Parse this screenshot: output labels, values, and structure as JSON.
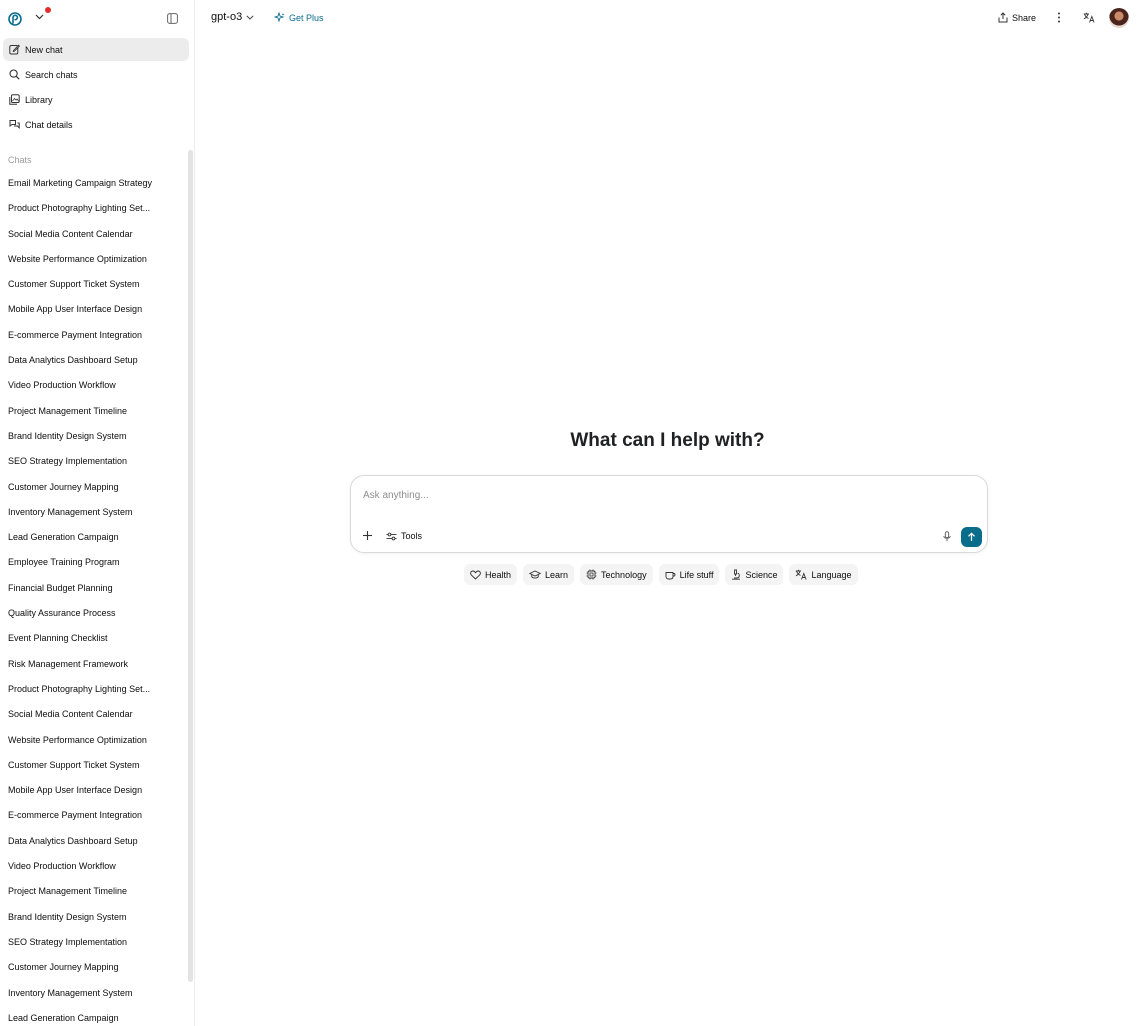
{
  "sidebar": {
    "nav": [
      {
        "label": "New chat",
        "icon": "edit-icon"
      },
      {
        "label": "Search chats",
        "icon": "search-icon"
      },
      {
        "label": "Library",
        "icon": "library-icon"
      },
      {
        "label": "Chat details",
        "icon": "chat-details-icon"
      }
    ],
    "chats_label": "Chats",
    "chats": [
      "Email Marketing Campaign Strategy",
      "Product Photography Lighting Set...",
      "Social Media Content Calendar",
      "Website Performance Optimization",
      "Customer Support Ticket System",
      "Mobile App User Interface Design",
      "E-commerce Payment Integration",
      "Data Analytics Dashboard Setup",
      "Video Production Workflow",
      "Project Management Timeline",
      "Brand Identity Design System",
      "SEO Strategy Implementation",
      "Customer Journey Mapping",
      "Inventory Management System",
      "Lead Generation Campaign",
      "Employee Training Program",
      "Financial Budget Planning",
      "Quality Assurance Process",
      "Event Planning Checklist",
      "Risk Management Framework",
      "Product Photography Lighting Set...",
      "Social Media Content Calendar",
      "Website Performance Optimization",
      "Customer Support Ticket System",
      "Mobile App User Interface Design",
      "E-commerce Payment Integration",
      "Data Analytics Dashboard Setup",
      "Video Production Workflow",
      "Project Management Timeline",
      "Brand Identity Design System",
      "SEO Strategy Implementation",
      "Customer Journey Mapping",
      "Inventory Management System",
      "Lead Generation Campaign"
    ]
  },
  "header": {
    "model": "gpt-o3",
    "get_plus": "Get Plus",
    "share": "Share"
  },
  "main": {
    "title": "What can I help with?",
    "composer": {
      "placeholder": "Ask anything...",
      "tools_label": "Tools"
    },
    "chips": [
      {
        "label": "Health",
        "icon": "heart-icon"
      },
      {
        "label": "Learn",
        "icon": "graduation-cap-icon"
      },
      {
        "label": "Technology",
        "icon": "chip-icon"
      },
      {
        "label": "Life stuff",
        "icon": "coffee-icon"
      },
      {
        "label": "Science",
        "icon": "microscope-icon"
      },
      {
        "label": "Language",
        "icon": "translate-icon"
      }
    ]
  },
  "colors": {
    "accent": "#0b6d8c",
    "notification": "#e02e2a",
    "active_bg": "#ececec",
    "chip_bg": "#f4f4f4"
  }
}
